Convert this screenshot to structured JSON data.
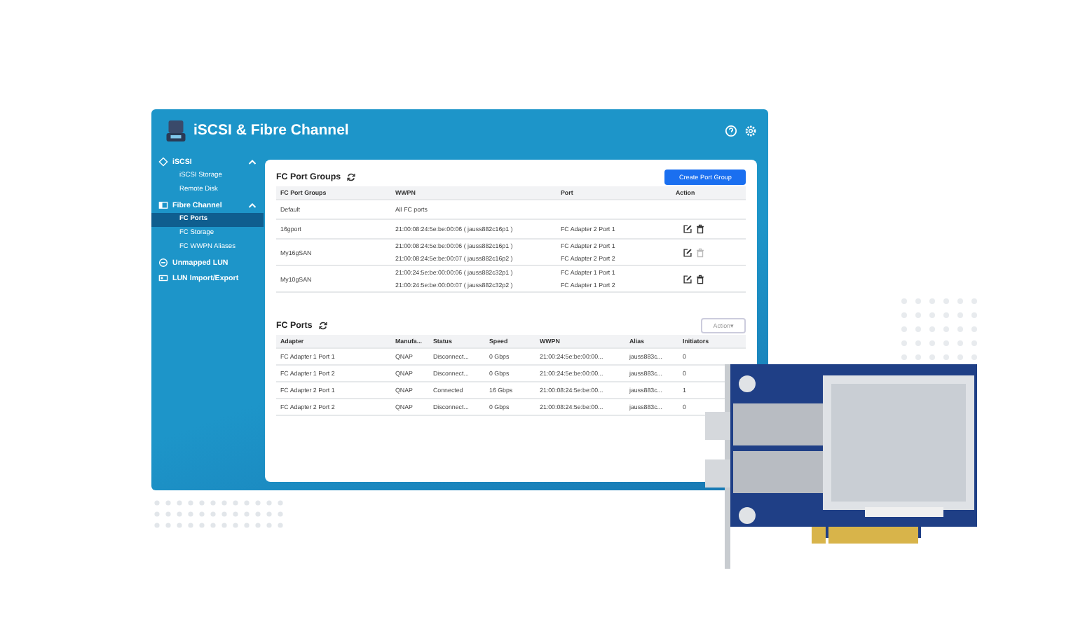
{
  "window": {
    "title": "iSCSI & Fibre Channel"
  },
  "sidebar": {
    "items": [
      {
        "label": "iSCSI",
        "expanded": true,
        "children": [
          {
            "label": "iSCSI Storage",
            "selected": false
          },
          {
            "label": "Remote Disk",
            "selected": false
          }
        ]
      },
      {
        "label": "Fibre Channel",
        "expanded": true,
        "children": [
          {
            "label": "FC Ports",
            "selected": true
          },
          {
            "label": "FC Storage",
            "selected": false
          },
          {
            "label": "FC WWPN Aliases",
            "selected": false
          }
        ]
      },
      {
        "label": "Unmapped LUN"
      },
      {
        "label": "LUN Import/Export"
      }
    ]
  },
  "port_groups": {
    "title": "FC Port Groups",
    "button": "Create Port Group",
    "columns": [
      "FC Port Groups",
      "WWPN",
      "Port",
      "Action"
    ],
    "rows": [
      {
        "name": "Default",
        "entries": [
          {
            "wwpn": "All FC ports"
          }
        ],
        "actions": []
      },
      {
        "name": "16gport",
        "entries": [
          {
            "wwpn": "21:00:08:24:5e:be:00:06 ( jauss882c16p1 )",
            "port": "FC Adapter 2 Port 1"
          }
        ],
        "actions": [
          {
            "kind": "edit",
            "disabled": false
          },
          {
            "kind": "delete",
            "disabled": false
          }
        ]
      },
      {
        "name": "My16gSAN",
        "entries": [
          {
            "wwpn": "21:00:08:24:5e:be:00:06 ( jauss882c16p1 )",
            "port": "FC Adapter 2 Port 1"
          },
          {
            "wwpn": "21:00:08:24:5e:be:00:07 ( jauss882c16p2 )",
            "port": "FC Adapter 2 Port 2"
          }
        ],
        "actions": [
          {
            "kind": "edit",
            "disabled": false
          },
          {
            "kind": "delete",
            "disabled": true
          }
        ]
      },
      {
        "name": "My10gSAN",
        "entries": [
          {
            "wwpn": "21:00:24:5e:be:00:00:06 ( jauss882c32p1 )",
            "port": "FC Adapter 1 Port 1"
          },
          {
            "wwpn": "21:00:24:5e:be:00:00:07 ( jauss882c32p2 )",
            "port": "FC Adapter 1 Port 2"
          }
        ],
        "actions": [
          {
            "kind": "edit",
            "disabled": false
          },
          {
            "kind": "delete",
            "disabled": false
          }
        ]
      }
    ]
  },
  "fc_ports": {
    "title": "FC Ports",
    "button": "Action▾",
    "columns": [
      "Adapter",
      "Manufa...",
      "Status",
      "Speed",
      "WWPN",
      "Alias",
      "Initiators"
    ],
    "rows": [
      [
        "FC Adapter 1 Port 1",
        "QNAP",
        "Disconnect...",
        "0 Gbps",
        "21:00:24:5e:be:00:00...",
        "jauss883c...",
        "0"
      ],
      [
        "FC Adapter 1 Port 2",
        "QNAP",
        "Disconnect...",
        "0 Gbps",
        "21:00:24:5e:be:00:00...",
        "jauss883c...",
        "0"
      ],
      [
        "FC Adapter 2 Port 1",
        "QNAP",
        "Connected",
        "16 Gbps",
        "21:00:08:24:5e:be:00...",
        "jauss883c...",
        "1"
      ],
      [
        "FC Adapter 2 Port 2",
        "QNAP",
        "Disconnect...",
        "0 Gbps",
        "21:00:08:24:5e:be:00...",
        "jauss883c...",
        "0"
      ]
    ]
  }
}
